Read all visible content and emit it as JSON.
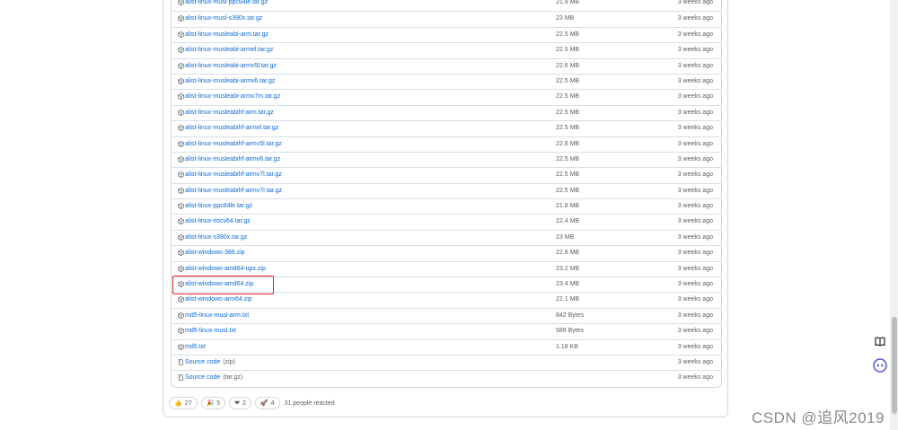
{
  "assets": [
    {
      "name": "alist-linux-musl-ppc64le.tar.gz",
      "size": "21.9 MB",
      "time": "3 weeks ago",
      "icon": "package-icon"
    },
    {
      "name": "alist-linux-musl-s390x.tar.gz",
      "size": "23 MB",
      "time": "3 weeks ago",
      "icon": "package-icon"
    },
    {
      "name": "alist-linux-musleabi-arm.tar.gz",
      "size": "22.5 MB",
      "time": "3 weeks ago",
      "icon": "package-icon"
    },
    {
      "name": "alist-linux-musleabi-armel.tar.gz",
      "size": "22.5 MB",
      "time": "3 weeks ago",
      "icon": "package-icon"
    },
    {
      "name": "alist-linux-musleabi-armv5l.tar.gz",
      "size": "22.6 MB",
      "time": "3 weeks ago",
      "icon": "package-icon"
    },
    {
      "name": "alist-linux-musleabi-armv6.tar.gz",
      "size": "22.5 MB",
      "time": "3 weeks ago",
      "icon": "package-icon"
    },
    {
      "name": "alist-linux-musleabi-armv7m.tar.gz",
      "size": "22.5 MB",
      "time": "3 weeks ago",
      "icon": "package-icon"
    },
    {
      "name": "alist-linux-musleabihf-arm.tar.gz",
      "size": "22.5 MB",
      "time": "3 weeks ago",
      "icon": "package-icon"
    },
    {
      "name": "alist-linux-musleabihf-armel.tar.gz",
      "size": "22.5 MB",
      "time": "3 weeks ago",
      "icon": "package-icon"
    },
    {
      "name": "alist-linux-musleabihf-armv5l.tar.gz",
      "size": "22.6 MB",
      "time": "3 weeks ago",
      "icon": "package-icon"
    },
    {
      "name": "alist-linux-musleabihf-armv6.tar.gz",
      "size": "22.5 MB",
      "time": "3 weeks ago",
      "icon": "package-icon"
    },
    {
      "name": "alist-linux-musleabihf-armv7l.tar.gz",
      "size": "22.5 MB",
      "time": "3 weeks ago",
      "icon": "package-icon"
    },
    {
      "name": "alist-linux-musleabihf-armv7r.tar.gz",
      "size": "22.5 MB",
      "time": "3 weeks ago",
      "icon": "package-icon"
    },
    {
      "name": "alist-linux-ppc64le.tar.gz",
      "size": "21.8 MB",
      "time": "3 weeks ago",
      "icon": "package-icon"
    },
    {
      "name": "alist-linux-riscv64.tar.gz",
      "size": "22.4 MB",
      "time": "3 weeks ago",
      "icon": "package-icon"
    },
    {
      "name": "alist-linux-s390x.tar.gz",
      "size": "23 MB",
      "time": "3 weeks ago",
      "icon": "package-icon"
    },
    {
      "name": "alist-windows-386.zip",
      "size": "22.8 MB",
      "time": "3 weeks ago",
      "icon": "package-icon"
    },
    {
      "name": "alist-windows-amd64-upx.zip",
      "size": "23.2 MB",
      "time": "3 weeks ago",
      "icon": "package-icon"
    },
    {
      "name": "alist-windows-amd64.zip",
      "size": "23.4 MB",
      "time": "3 weeks ago",
      "icon": "package-icon"
    },
    {
      "name": "alist-windows-arm64.zip",
      "size": "22.1 MB",
      "time": "3 weeks ago",
      "icon": "package-icon"
    },
    {
      "name": "md5-linux-musl-arm.txt",
      "size": "842 Bytes",
      "time": "3 weeks ago",
      "icon": "package-icon"
    },
    {
      "name": "md5-linux-musl.txt",
      "size": "589 Bytes",
      "time": "3 weeks ago",
      "icon": "package-icon"
    },
    {
      "name": "md5.txt",
      "size": "1.18 KB",
      "time": "3 weeks ago",
      "icon": "package-icon"
    },
    {
      "name": "Source code",
      "suffix": "(zip)",
      "size": "",
      "time": "3 weeks ago",
      "icon": "file-zip-icon"
    },
    {
      "name": "Source code",
      "suffix": "(tar.gz)",
      "size": "",
      "time": "3 weeks ago",
      "icon": "file-zip-icon"
    }
  ],
  "reactions": {
    "items": [
      {
        "emoji": "👍",
        "count": "27",
        "icon": "thumbs-up-icon"
      },
      {
        "emoji": "🎉",
        "count": "5",
        "icon": "party-popper-icon"
      },
      {
        "emoji": "❤",
        "count": "2",
        "icon": "heart-icon"
      },
      {
        "emoji": "🚀",
        "count": "4",
        "icon": "rocket-icon"
      }
    ],
    "summary": "31 people reacted"
  },
  "side_tools": [
    {
      "icon": "book-icon"
    },
    {
      "icon": "chat-bot-icon"
    }
  ],
  "watermark": "CSDN @追风2019",
  "colors": {
    "link": "#0969da",
    "muted": "#57606a",
    "border": "#d0d7de",
    "highlight": "#e0262a"
  }
}
